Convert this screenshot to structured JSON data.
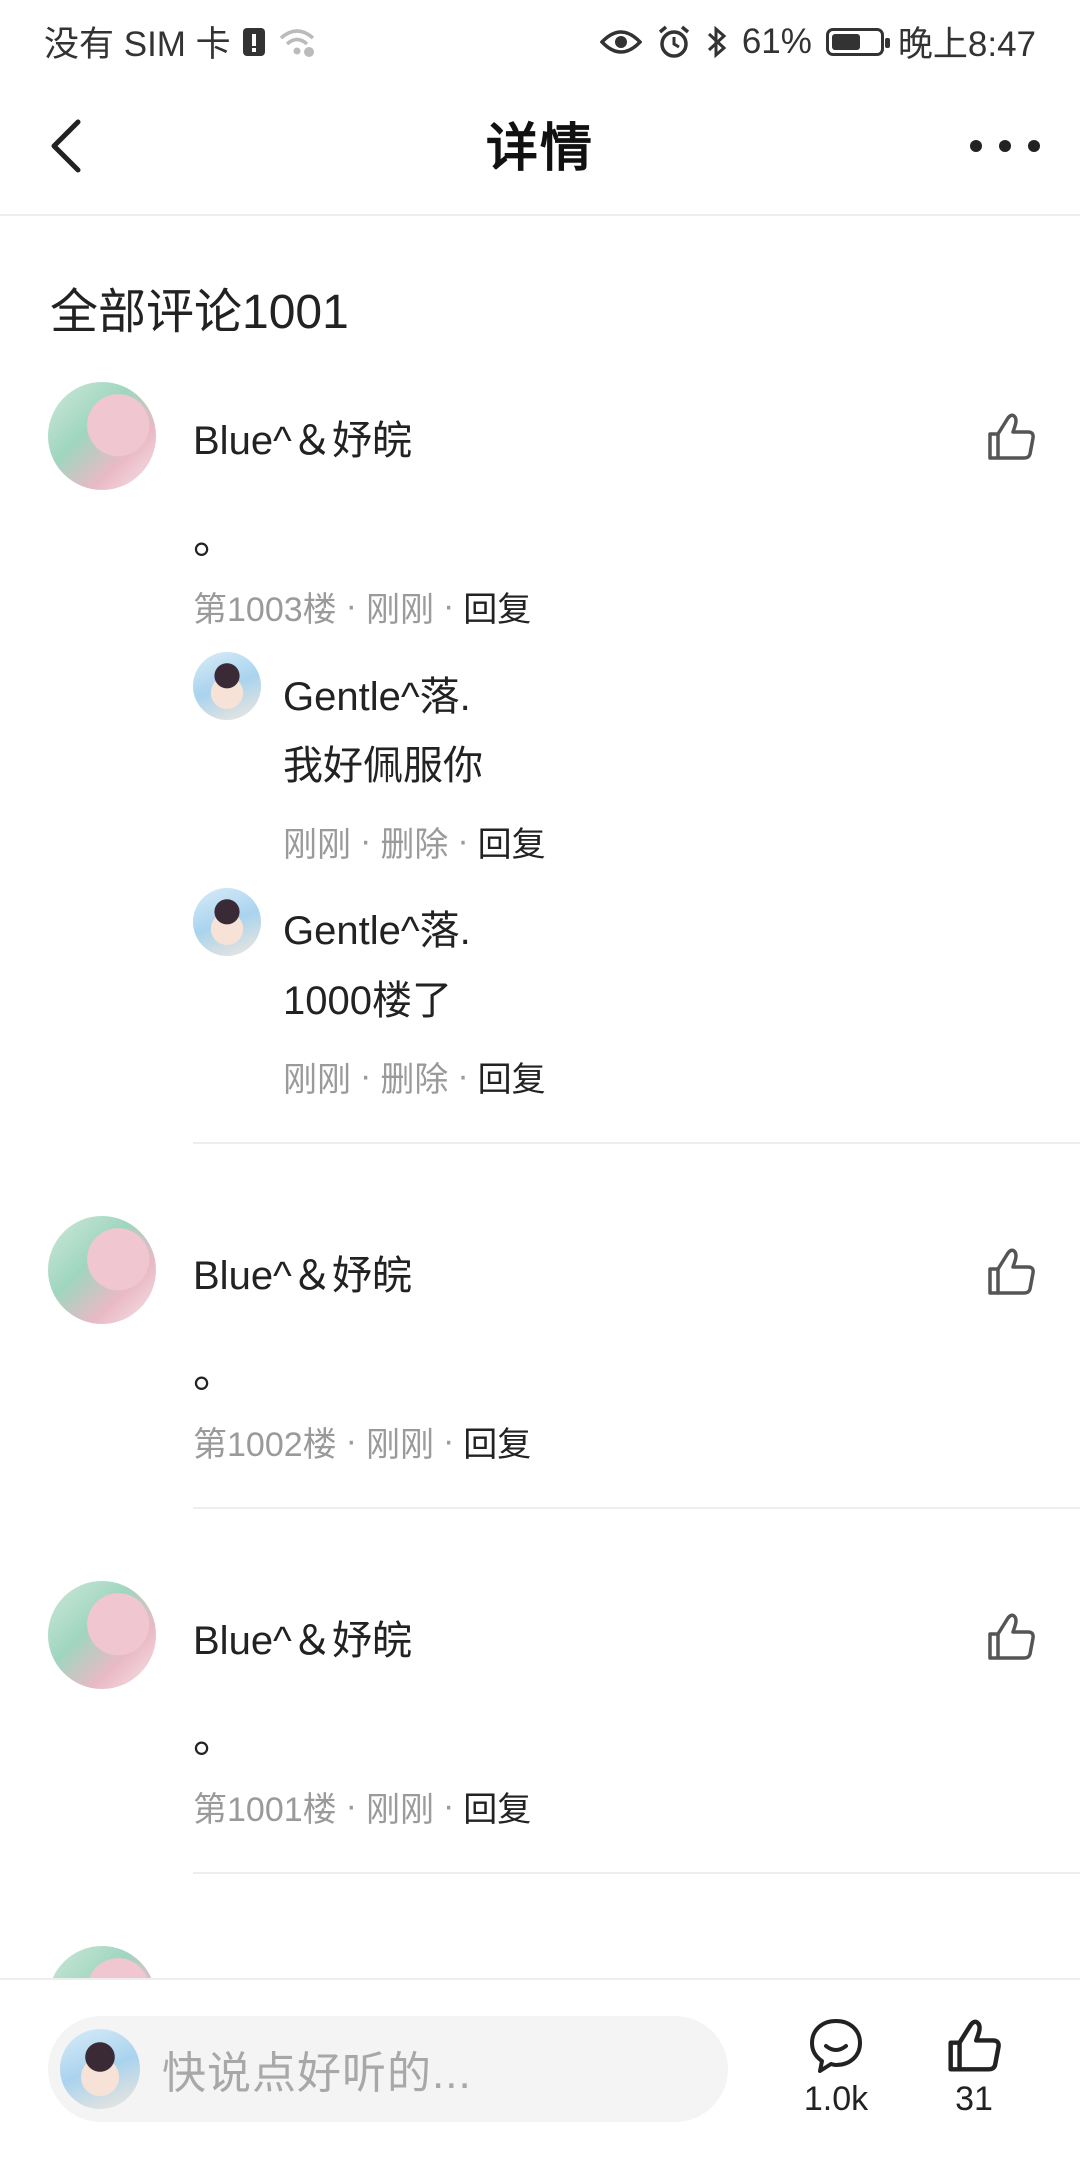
{
  "status_bar": {
    "carrier": "没有 SIM 卡",
    "battery_percent": "61%",
    "battery_level": 0.61,
    "time": "晚上8:47"
  },
  "header": {
    "title": "详情"
  },
  "comments_section": {
    "heading": "全部评论1001"
  },
  "comments": [
    {
      "author": "Blue^＆妤皖",
      "body": "。",
      "floor": "第1003楼",
      "time": "刚刚",
      "reply": "回复",
      "replies": [
        {
          "author": "Gentle^落.",
          "body": "我好佩服你",
          "time": "刚刚",
          "delete": "删除",
          "reply": "回复"
        },
        {
          "author": "Gentle^落.",
          "body": "1000楼了",
          "time": "刚刚",
          "delete": "删除",
          "reply": "回复"
        }
      ]
    },
    {
      "author": "Blue^＆妤皖",
      "body": "。",
      "floor": "第1002楼",
      "time": "刚刚",
      "reply": "回复"
    },
    {
      "author": "Blue^＆妤皖",
      "body": "。",
      "floor": "第1001楼",
      "time": "刚刚",
      "reply": "回复"
    }
  ],
  "bottom_bar": {
    "input_placeholder": "快说点好听的...",
    "comment_count": "1.0k",
    "like_count": "31"
  },
  "icons": {
    "back": "back-arrow-icon",
    "more": "more-dots-icon",
    "like": "thumbs-up-icon",
    "comment": "comment-bubble-icon"
  }
}
